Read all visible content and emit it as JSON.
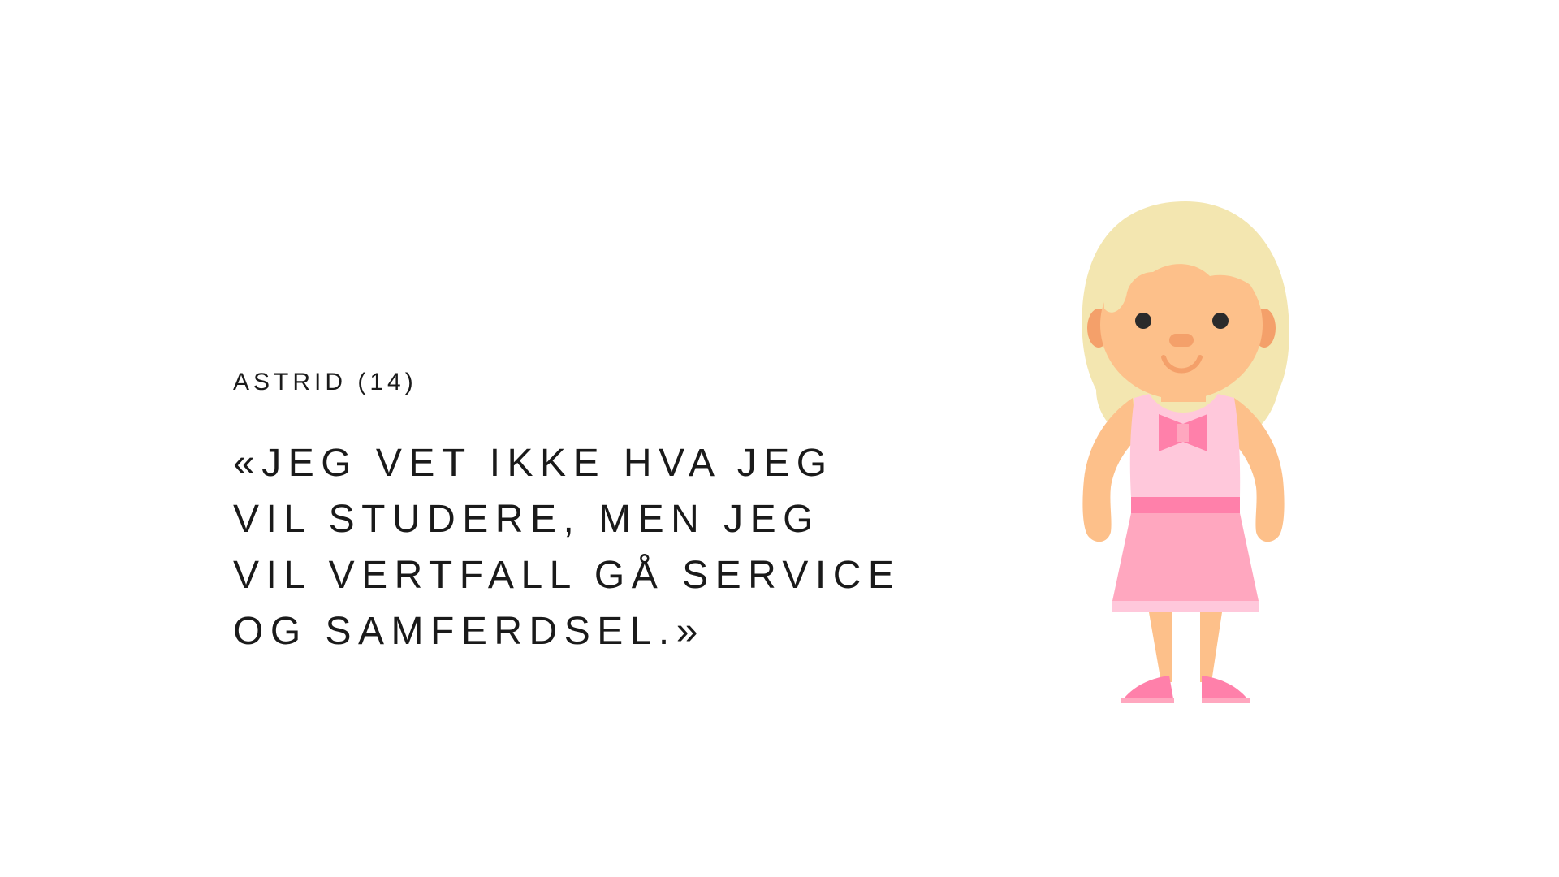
{
  "slide": {
    "speaker": "ASTRID (14)",
    "quote_lines": [
      "«JEG VET IKKE HVA JEG",
      "VIL STUDERE, MEN JEG",
      "VIL VERTFALL GÅ SERVICE",
      "OG SAMFERDSEL.»"
    ]
  },
  "colors": {
    "text": "#1a1a1a",
    "hair": "#F3E6B0",
    "skin": "#FDC08A",
    "cheek": "#F4A06A",
    "dress_top": "#FFC8DB",
    "dress_belt": "#FF80AA",
    "dress_skirt": "#FFA7BF",
    "shoes": "#FF80AA"
  },
  "icons": {
    "illustration": "girl-character-icon"
  }
}
